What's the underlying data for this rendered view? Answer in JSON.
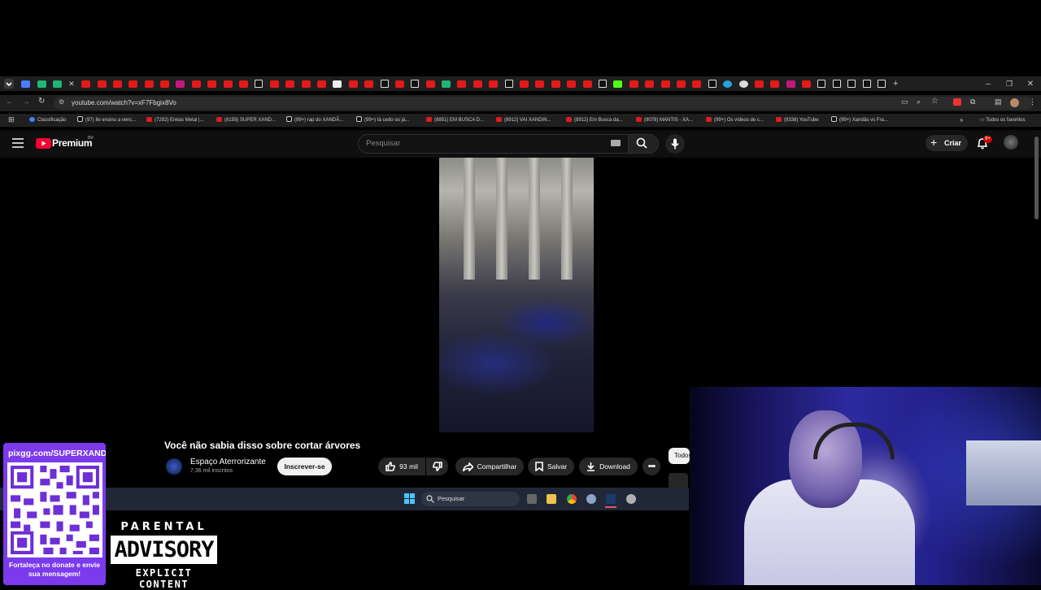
{
  "browser": {
    "url": "youtube.com/watch?v=xF7Fbgix8Vo",
    "bookmarks": [
      {
        "label": "Classificação"
      },
      {
        "label": "(97) Ile ensino a venc..."
      },
      {
        "label": "(7292) Enéas Metal |..."
      },
      {
        "label": "(8159) SUPER XAND..."
      },
      {
        "label": "(99+) rap do XANDÃ..."
      },
      {
        "label": "(99+) tá cedo ou já..."
      },
      {
        "label": "(8851) EM BUSCA D..."
      },
      {
        "label": "(8912) VAI XANDIN..."
      },
      {
        "label": "(8912) Em Busca da..."
      },
      {
        "label": "(9078) MANTIS - XA..."
      },
      {
        "label": "(99+) Os vídeos de c..."
      },
      {
        "label": "(9338) YouTube"
      },
      {
        "label": "(99+) Xandão vs Fra..."
      }
    ],
    "all_bookmarks": "Todos os favoritos"
  },
  "youtube": {
    "logo": "Premium",
    "logo_badge": "BR",
    "search_placeholder": "Pesquisar",
    "create_label": "Criar",
    "notif_count": "9+",
    "video_title": "Você não sabia disso sobre cortar árvores",
    "channel_name": "Espaço Aterrorizante",
    "channel_subs": "7,36 mil inscritos",
    "subscribe_label": "Inscrever-se",
    "likes": "93 mil",
    "share_label": "Compartilhar",
    "save_label": "Salvar",
    "download_label": "Download",
    "chip_label": "Todos"
  },
  "taskbar": {
    "search_placeholder": "Pesquisar"
  },
  "overlay": {
    "qr_url": "pixgg.com/SUPERXANDÃO",
    "qr_caption": "Fortaleça no donate e envie sua mensagem!",
    "pa_top": "PARENTAL",
    "pa_mid": "ADVISORY",
    "pa_bottom": "EXPLICIT CONTENT"
  },
  "colors": {
    "yt_red": "#ff0033",
    "qr_purple": "#7c3aed",
    "taskbar": "#202838"
  }
}
